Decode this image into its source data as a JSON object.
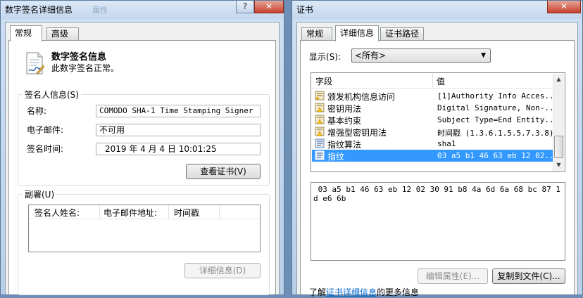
{
  "left_window": {
    "title": "数字签名详细信息",
    "ghost_title": "属性",
    "help_btn": "?",
    "close_btn": "✕",
    "tabs": [
      "常规",
      "高级"
    ],
    "header": {
      "title": "数字签名信息",
      "subtitle": "此数字签名正常。"
    },
    "signer_group": {
      "title": "签名人信息(S)",
      "name_label": "名称:",
      "name_value": "COMODO SHA-1 Time Stamping Signer",
      "email_label": "电子邮件:",
      "email_value": "不可用",
      "time_label": "签名时间:",
      "time_value": "2019  年  4  月  4  日 10:01:25",
      "view_cert_button": "查看证书(V)"
    },
    "countersign_group": {
      "title": "副署(U)",
      "columns": [
        "签名人姓名:",
        "电子邮件地址:",
        "时间戳"
      ],
      "details_button": "详细信息(D)"
    }
  },
  "right_window": {
    "title": "证书",
    "close_btn": "✕",
    "tabs": [
      "常规",
      "详细信息",
      "证书路径"
    ],
    "show_label": "显示(S):",
    "show_value": "<所有>",
    "columns": {
      "field": "字段",
      "value": "值"
    },
    "rows": [
      {
        "field": "颁发机构信息访问",
        "value": "[1]Authority Info Acces..."
      },
      {
        "field": "密钥用法",
        "value": "Digital Signature, Non-..."
      },
      {
        "field": "基本约束",
        "value": "Subject Type=End Entity..."
      },
      {
        "field": "增强型密钥用法",
        "value": "时间戳 (1.3.6.1.5.5.7.3.8)"
      },
      {
        "field": "指纹算法",
        "value": "sha1"
      },
      {
        "field": "指纹",
        "value": "03 a5 b1 46 63 eb 12 02..."
      }
    ],
    "detail_text": " 03 a5 b1 46 63 eb 12 02 30 91 b8 4a 6d 6a 68 bc 87 1d e6 6b",
    "edit_props_button": "编辑属性(E)...",
    "copy_to_file_button": "复制到文件(C)...",
    "learn_more": {
      "prefix": "了解",
      "link": "证书详细信息",
      "suffix": "的更多信息"
    }
  }
}
